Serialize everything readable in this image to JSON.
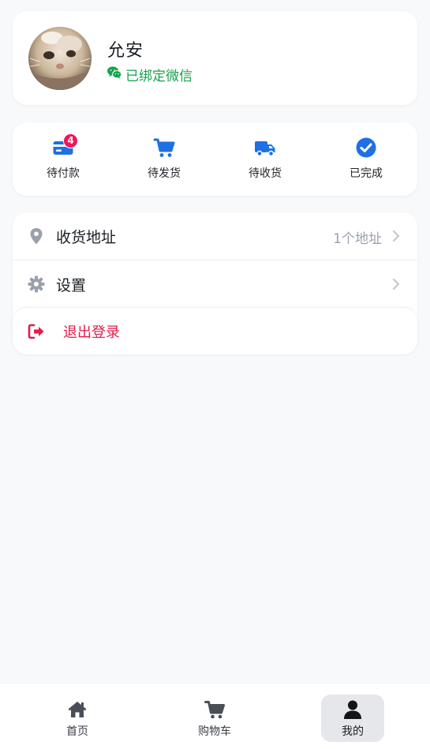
{
  "profile": {
    "username": "允安",
    "wechat_status": "已绑定微信"
  },
  "orders": [
    {
      "label": "待付款",
      "icon": "credit-card-icon",
      "badge": "4"
    },
    {
      "label": "待发货",
      "icon": "cart-icon"
    },
    {
      "label": "待收货",
      "icon": "truck-icon"
    },
    {
      "label": "已完成",
      "icon": "check-circle-icon"
    }
  ],
  "menu": {
    "address": {
      "label": "收货地址",
      "value": "1个地址",
      "icon": "location-pin-icon"
    },
    "settings": {
      "label": "设置",
      "icon": "gear-icon"
    },
    "logout": {
      "label": "退出登录",
      "icon": "logout-icon"
    }
  },
  "tabbar": [
    {
      "label": "首页",
      "icon": "home-icon"
    },
    {
      "label": "购物车",
      "icon": "cart-icon"
    },
    {
      "label": "我的",
      "icon": "user-icon",
      "active": true
    }
  ],
  "colors": {
    "accent_blue": "#1f6fe5",
    "wechat_green": "#13a34a",
    "danger": "#e11d48",
    "badge": "#f0145a",
    "muted": "#9aa1ad"
  }
}
